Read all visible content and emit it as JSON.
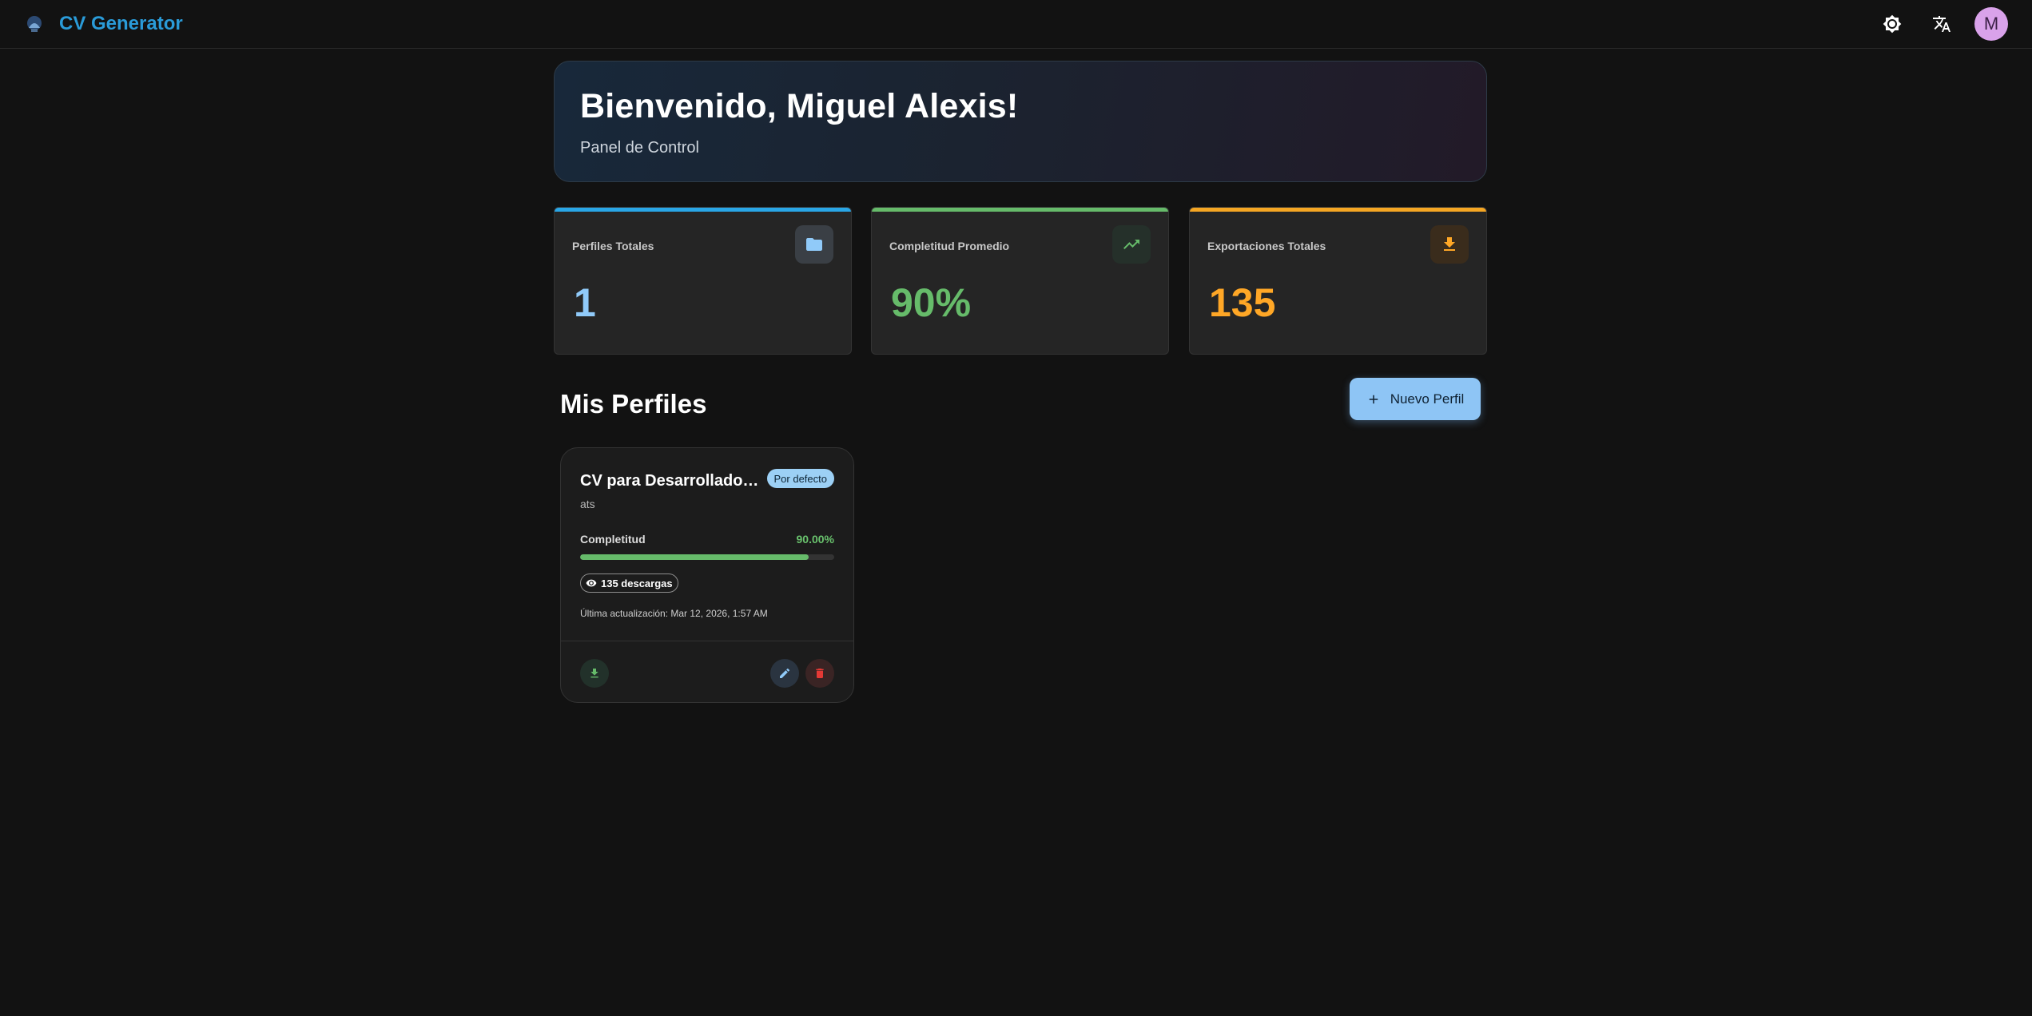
{
  "app": {
    "name": "CV Generator",
    "avatar_letter": "M"
  },
  "welcome": {
    "title": "Bienvenido, Miguel Alexis!",
    "subtitle": "Panel de Control"
  },
  "stats": [
    {
      "label": "Perfiles Totales",
      "value": "1",
      "accent": "#29a6e6",
      "value_color": "#90caf9",
      "icon": "folder-icon",
      "icon_color": "#90caf9",
      "icon_bg": "#3a3f45"
    },
    {
      "label": "Completitud Promedio",
      "value": "90%",
      "accent": "#66bb6a",
      "value_color": "#66bb6a",
      "icon": "trending-up-icon",
      "icon_color": "#66bb6a",
      "icon_bg": "#25302a"
    },
    {
      "label": "Exportaciones Totales",
      "value": "135",
      "accent": "#f5a623",
      "value_color": "#ffa726",
      "icon": "download-icon",
      "icon_color": "#ffa726",
      "icon_bg": "#3a2c1c"
    }
  ],
  "profiles_section": {
    "title": "Mis Perfiles",
    "new_button": "Nuevo Perfil"
  },
  "profile_card": {
    "title": "CV para Desarrollador ...",
    "badge": "Por defecto",
    "template": "ats",
    "completeness_label": "Completitud",
    "completeness_value": "90.00%",
    "completeness_fraction": 0.9,
    "downloads": "135 descargas",
    "updated": "Última actualización: Mar 12, 2026, 1:57 AM"
  },
  "colors": {
    "brand": "#2a9bd8",
    "primary_button": "#8ec5f5",
    "success": "#66bb6a",
    "danger": "#e53935"
  }
}
